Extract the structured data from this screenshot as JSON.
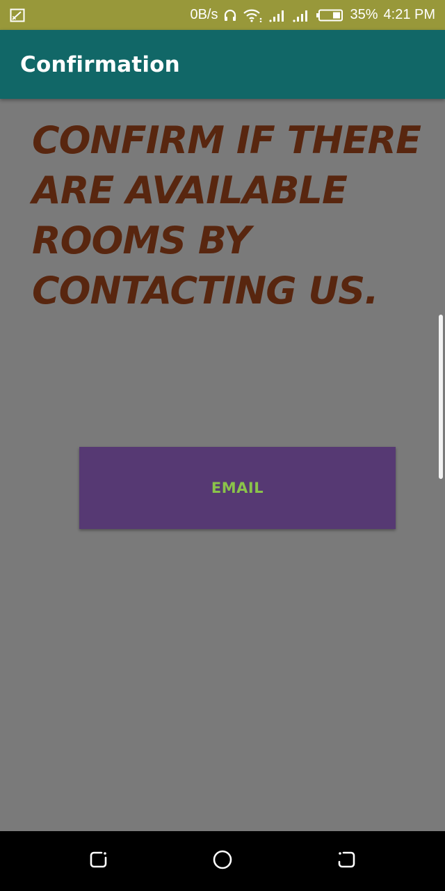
{
  "status_bar": {
    "net_speed": "0B/s",
    "battery_percent": "35%",
    "time": "4:21 PM",
    "icons": [
      "screen-cast-icon",
      "headphones-icon",
      "wifi-icon",
      "signal-icon",
      "signal-icon",
      "battery-icon"
    ]
  },
  "app_bar": {
    "title": "Confirmation"
  },
  "main": {
    "heading": "CONFIRM IF THERE ARE AVAILABLE ROOMS BY CONTACTING US.",
    "email_button_label": "EMAIL"
  },
  "nav_bar": {
    "icons": [
      "recent-apps-icon",
      "home-icon",
      "back-icon"
    ]
  },
  "colors": {
    "status_bar": "#98983a",
    "app_bar": "#116767",
    "background": "#7a7a7a",
    "heading_text": "#58260f",
    "button_bg": "#563973",
    "button_text": "#8bc34a"
  }
}
